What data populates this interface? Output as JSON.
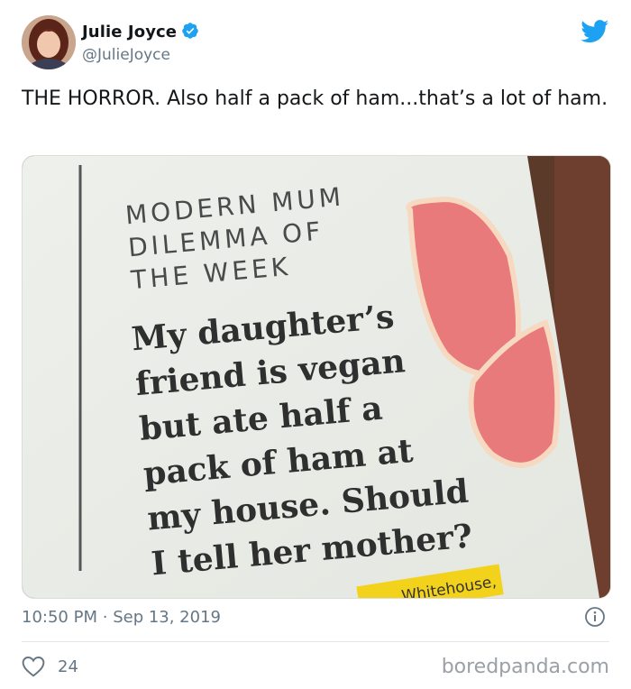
{
  "author": {
    "name": "Julie Joyce",
    "handle": "@JulieJoyce",
    "verified": true
  },
  "tweet": {
    "text": "THE HORROR. Also half a pack of ham...that’s a lot of ham.",
    "time": "10:50 PM",
    "separator": "·",
    "date": "Sep 13, 2019",
    "like_count": "24"
  },
  "photo": {
    "kicker_lines": [
      "MODERN MUM",
      "DILEMMA OF",
      "THE WEEK"
    ],
    "headline_lines": [
      "My daughter’s",
      "friend is vegan",
      "but ate half a",
      "pack of ham at",
      "my house. Should",
      "I tell her mother?"
    ],
    "byline": "Whitehouse,"
  },
  "watermark": "boredpanda.com",
  "colors": {
    "twitter_blue": "#1da1f2",
    "secondary_text": "#657786",
    "ham_pink": "#e97a7c"
  },
  "icons": {
    "verified": "verified-badge-icon",
    "brand": "twitter-bird-icon",
    "info": "info-icon",
    "like": "heart-icon"
  }
}
